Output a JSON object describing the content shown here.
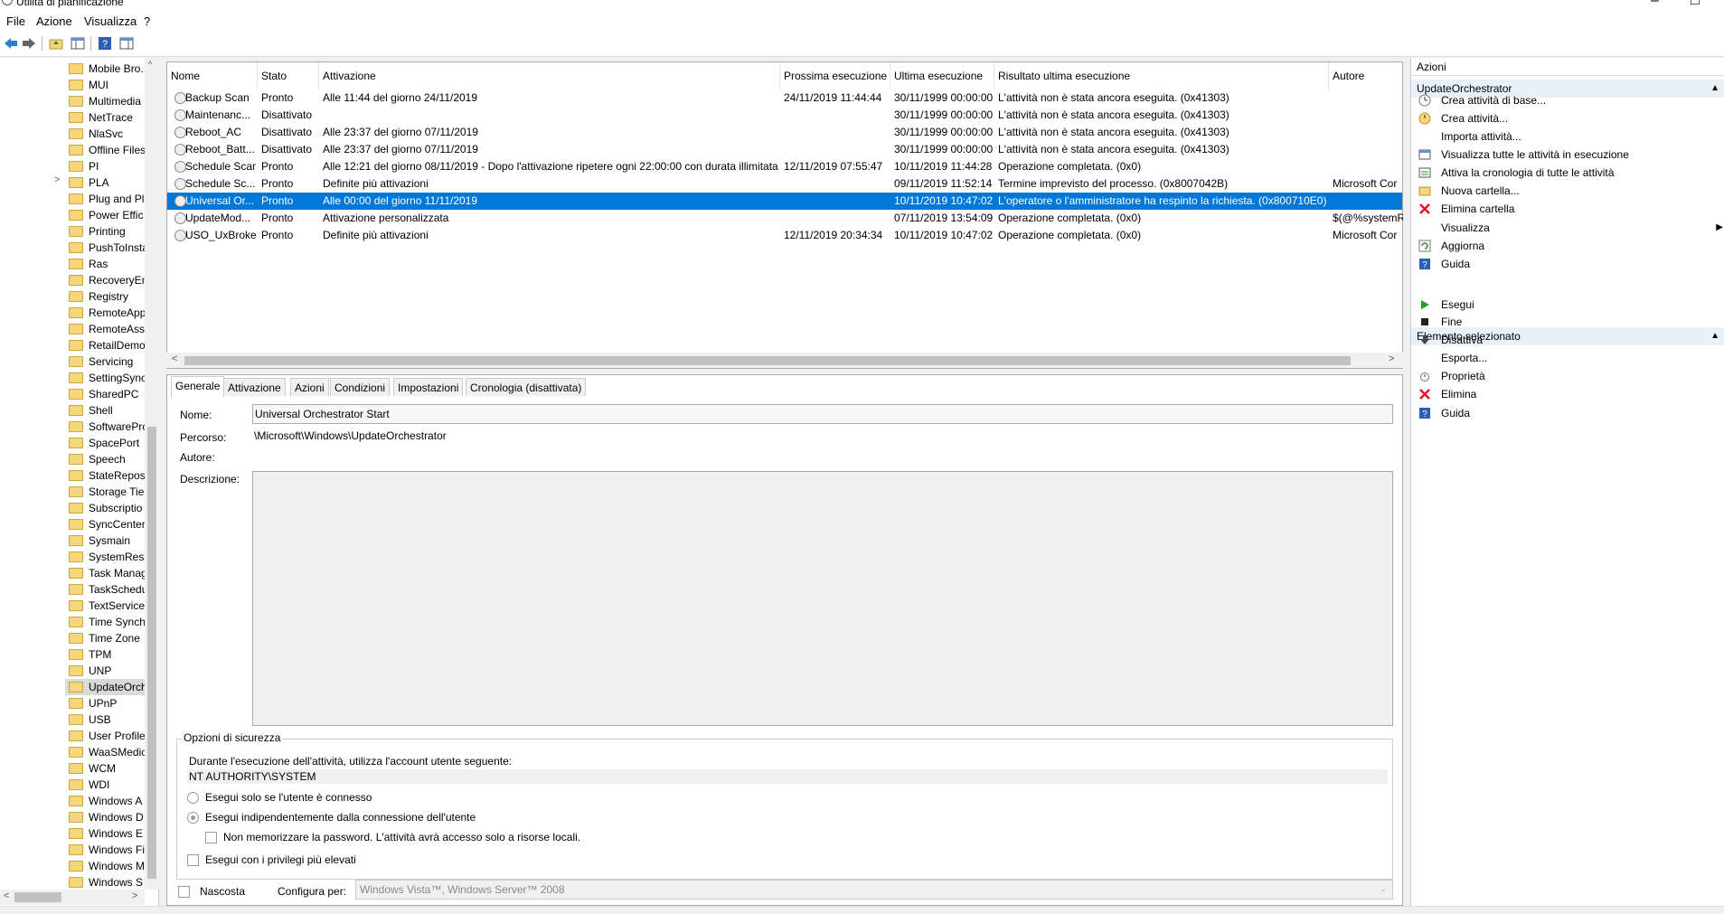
{
  "window": {
    "title": "Utilità di pianificazione",
    "minimize": "–",
    "maximize": "□"
  },
  "menu": [
    "File",
    "Azione",
    "Visualizza",
    "?"
  ],
  "tree": {
    "items": [
      "Mobile Bro...",
      "MUI",
      "Multimedia",
      "NetTrace",
      "NlaSvc",
      "Offline Files",
      "PI",
      "PLA",
      "Plug and Pl",
      "Power Effic",
      "Printing",
      "PushToInsta",
      "Ras",
      "RecoveryEn",
      "Registry",
      "RemoteApp",
      "RemoteAss",
      "RetailDemo",
      "Servicing",
      "SettingSync",
      "SharedPC",
      "Shell",
      "SoftwarePro",
      "SpacePort",
      "Speech",
      "StateReposi",
      "Storage Tier",
      "Subscriptio",
      "SyncCenter",
      "Sysmain",
      "SystemRest",
      "Task Manag",
      "TaskSchedu",
      "TextServices",
      "Time Synch",
      "Time Zone",
      "TPM",
      "UNP",
      "UpdateOrch",
      "UPnP",
      "USB",
      "User Profile",
      "WaaSMedic",
      "WCM",
      "WDI",
      "Windows A",
      "Windows D",
      "Windows E",
      "Windows Fi",
      "Windows M",
      "Windows S"
    ],
    "selected_index": 38,
    "expandable_index": 7
  },
  "task_list": {
    "columns": [
      "Nome",
      "Stato",
      "Attivazione",
      "Prossima esecuzione",
      "Ultima esecuzione",
      "Risultato ultima esecuzione",
      "Autore"
    ],
    "rows": [
      [
        "Backup Scan",
        "Pronto",
        "Alle 11:44 del giorno 24/11/2019",
        "24/11/2019 11:44:44",
        "30/11/1999 00:00:00",
        "L'attività non è stata ancora eseguita. (0x41303)",
        ""
      ],
      [
        "Maintenanc...",
        "Disattivato",
        "",
        "",
        "30/11/1999 00:00:00",
        "L'attività non è stata ancora eseguita. (0x41303)",
        ""
      ],
      [
        "Reboot_AC",
        "Disattivato",
        "Alle 23:37 del giorno 07/11/2019",
        "",
        "30/11/1999 00:00:00",
        "L'attività non è stata ancora eseguita. (0x41303)",
        ""
      ],
      [
        "Reboot_Batt...",
        "Disattivato",
        "Alle 23:37 del giorno 07/11/2019",
        "",
        "30/11/1999 00:00:00",
        "L'attività non è stata ancora eseguita. (0x41303)",
        ""
      ],
      [
        "Schedule Scan",
        "Pronto",
        "Alle 12:21 del giorno 08/11/2019 - Dopo l'attivazione ripetere ogni 22:00:00 con durata illimitata.",
        "12/11/2019 07:55:47",
        "10/11/2019 11:44:28",
        "Operazione completata. (0x0)",
        ""
      ],
      [
        "Schedule Sc...",
        "Pronto",
        "Definite più attivazioni",
        "",
        "09/11/2019 11:52:14",
        "Termine imprevisto del processo. (0x8007042B)",
        "Microsoft Cor"
      ],
      [
        "Universal Or...",
        "Pronto",
        "Alle 00:00 del giorno 11/11/2019",
        "",
        "10/11/2019 10:47:02",
        "L'operatore o l'amministratore ha respinto la richiesta. (0x800710E0)",
        ""
      ],
      [
        "UpdateMod...",
        "Pronto",
        "Attivazione personalizzata",
        "",
        "07/11/2019 13:54:09",
        "Operazione completata. (0x0)",
        "$(@%systemR"
      ],
      [
        "USO_UxBroker",
        "Pronto",
        "Definite più attivazioni",
        "12/11/2019 20:34:34",
        "10/11/2019 10:47:02",
        "Operazione completata. (0x0)",
        "Microsoft Cor"
      ]
    ],
    "selected_index": 6
  },
  "detail": {
    "tabs": [
      "Generale",
      "Attivazione",
      "Azioni",
      "Condizioni",
      "Impostazioni",
      "Cronologia (disattivata)"
    ],
    "active_tab": 0,
    "name_label": "Nome:",
    "name_value": "Universal Orchestrator Start",
    "path_label": "Percorso:",
    "path_value": "\\Microsoft\\Windows\\UpdateOrchestrator",
    "author_label": "Autore:",
    "author_value": "",
    "desc_label": "Descrizione:",
    "desc_value": "",
    "security": {
      "title": "Opzioni di sicurezza",
      "account_label": "Durante l'esecuzione dell'attività, utilizza l'account utente seguente:",
      "account_value": "NT AUTHORITY\\SYSTEM",
      "opt_logged_on": "Esegui solo se l'utente è connesso",
      "opt_regardless": "Esegui indipendentemente dalla connessione dell'utente",
      "opt_no_password": "Non memorizzare la password. L'attività avrà accesso solo a risorse locali.",
      "opt_highest": "Esegui con i privilegi più elevati"
    },
    "hidden_label": "Nascosta",
    "configure_label": "Configura per:",
    "configure_value": "Windows Vista™, Windows Server™ 2008"
  },
  "actions": {
    "title": "Azioni",
    "section1": "UpdateOrchestrator",
    "items1": [
      {
        "label": "Crea attività di base...",
        "icon": "create-basic-task-icon"
      },
      {
        "label": "Crea attività...",
        "icon": "create-task-icon"
      },
      {
        "label": "Importa attività...",
        "icon": ""
      },
      {
        "label": "Visualizza tutte le attività in esecuzione",
        "icon": "running-tasks-icon"
      },
      {
        "label": "Attiva la cronologia di tutte le attività",
        "icon": "history-icon"
      },
      {
        "label": "Nuova cartella...",
        "icon": "new-folder-icon"
      },
      {
        "label": "Elimina cartella",
        "icon": "delete-folder-icon"
      },
      {
        "label": "Visualizza",
        "icon": ""
      },
      {
        "label": "Aggiorna",
        "icon": "refresh-icon"
      },
      {
        "label": "Guida",
        "icon": "help-icon"
      }
    ],
    "section2": "Elemento selezionato",
    "items2": [
      {
        "label": "Esegui",
        "icon": "run-icon"
      },
      {
        "label": "Fine",
        "icon": "stop-icon"
      },
      {
        "label": "Disattiva",
        "icon": "disable-icon"
      },
      {
        "label": "Esporta...",
        "icon": ""
      },
      {
        "label": "Proprietà",
        "icon": "properties-icon"
      },
      {
        "label": "Elimina",
        "icon": "delete-icon"
      },
      {
        "label": "Guida",
        "icon": "help-icon"
      }
    ]
  },
  "colors": {
    "selection": "#0078d7",
    "accent_red": "#e81123",
    "accent_green": "#22a022",
    "help_blue": "#2b5fb3"
  }
}
